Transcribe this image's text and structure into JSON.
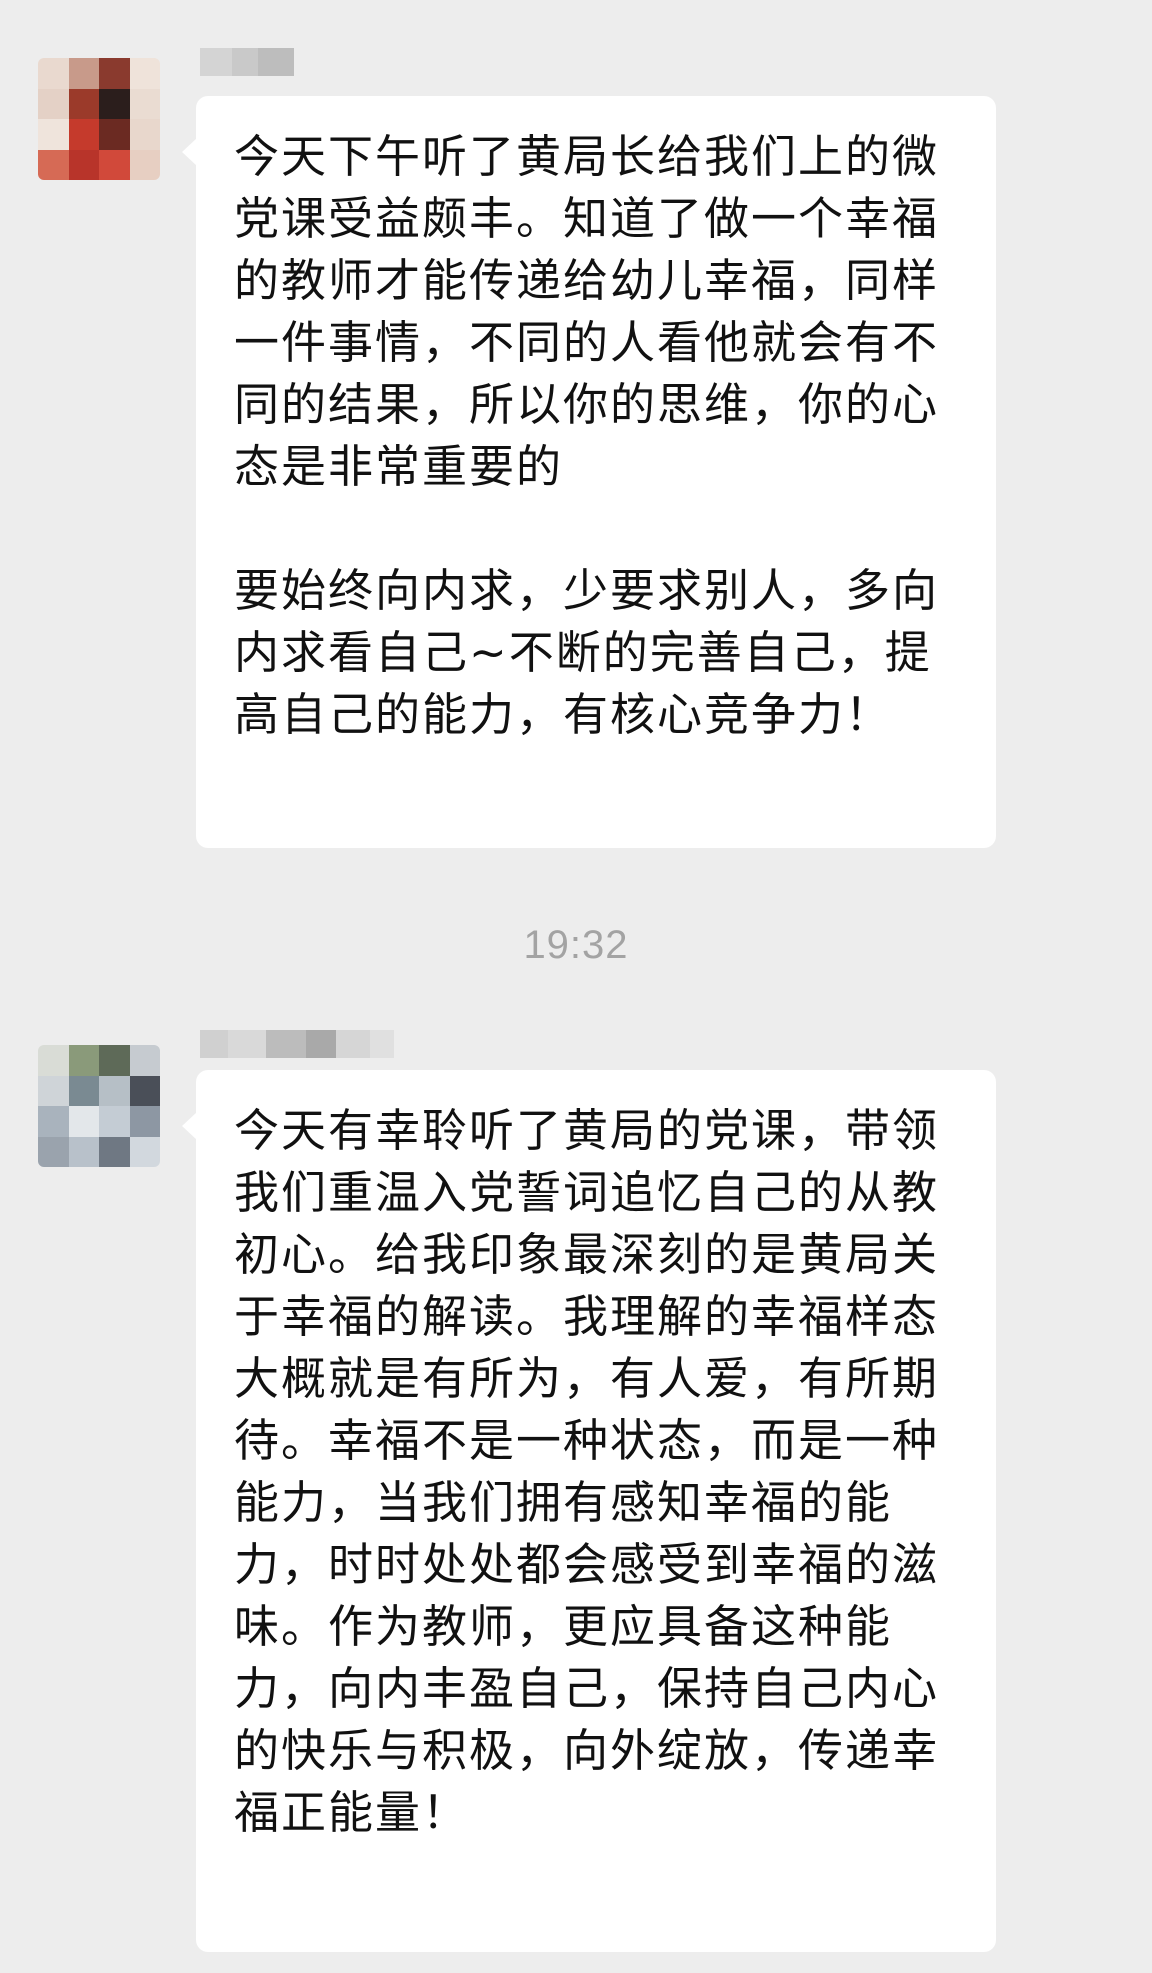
{
  "chat": {
    "messages": [
      {
        "sender_name": "",
        "paragraphs": [
          "今天下午听了黄局长给我们上的微党课受益颇丰。知道了做一个幸福的教师才能传递给幼儿幸福，同样一件事情，不同的人看他就会有不同的结果，所以你的思维，你的心态是非常重要的",
          "要始终向内求，少要求别人，多向内求看自己~不断的完善自己，提高自己的能力，有核心竞争力！"
        ]
      },
      {
        "sender_name": "",
        "paragraphs": [
          "今天有幸聆听了黄局的党课，带领我们重温入党誓词追忆自己的从教初心。给我印象最深刻的是黄局关于幸福的解读。我理解的幸福样态大概就是有所为，有人爱，有所期待。幸福不是一种状态，而是一种能力，当我们拥有感知幸福的能力，时时处处都会感受到幸福的滋味。作为教师，更应具备这种能力，向内丰盈自己，保持自己内心的快乐与积极，向外绽放，传递幸福正能量！"
        ]
      }
    ],
    "timestamp": "19:32"
  },
  "colors": {
    "background": "#ededed",
    "bubble": "#ffffff",
    "text": "#111111",
    "timestamp": "#a3a3a3"
  },
  "icons": {
    "avatar_1": "blurred-avatar",
    "avatar_2": "blurred-avatar"
  }
}
